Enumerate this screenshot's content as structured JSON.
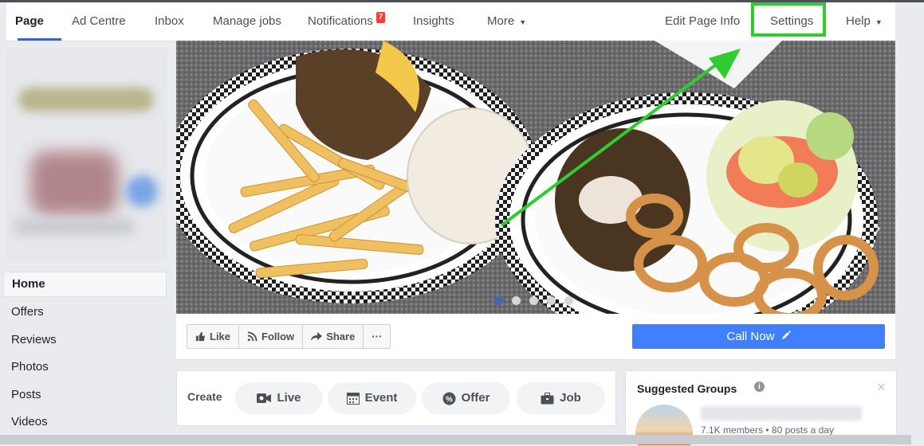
{
  "topnav": {
    "tabs": [
      {
        "label": "Page"
      },
      {
        "label": "Ad Centre"
      },
      {
        "label": "Inbox"
      },
      {
        "label": "Manage jobs"
      },
      {
        "label": "Notifications",
        "badge": "7"
      },
      {
        "label": "Insights"
      },
      {
        "label": "More"
      }
    ],
    "right": {
      "edit_page_info": "Edit Page Info",
      "settings": "Settings",
      "help": "Help"
    },
    "caret_glyph": "▼"
  },
  "sidebar": {
    "items": [
      {
        "label": "Home"
      },
      {
        "label": "Offers"
      },
      {
        "label": "Reviews"
      },
      {
        "label": "Photos"
      },
      {
        "label": "Posts"
      },
      {
        "label": "Videos"
      }
    ]
  },
  "cover": {
    "prev_glyph": "‹",
    "next_glyph": "›"
  },
  "actions": {
    "like": "Like",
    "follow": "Follow",
    "share": "Share",
    "more": "···",
    "call_now": "Call Now"
  },
  "create": {
    "label": "Create",
    "live": "Live",
    "event": "Event",
    "offer": "Offer",
    "job": "Job"
  },
  "suggested_groups": {
    "title": "Suggested Groups",
    "info": "i",
    "close": "×",
    "meta": "7.1K members • 80 posts a day"
  },
  "colors": {
    "accent": "#4267b2",
    "call_now": "#4080ff",
    "highlight": "#2ecc2e",
    "badge": "#fa3e3e"
  }
}
